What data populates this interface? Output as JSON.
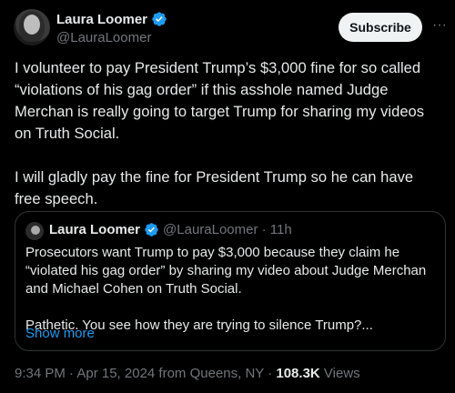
{
  "author": {
    "display_name": "Laura Loomer",
    "handle": "@LauraLoomer",
    "verified_icon": "verified-badge-icon"
  },
  "actions": {
    "subscribe_label": "Subscribe",
    "more_label": "···"
  },
  "tweet": {
    "paragraphs": [
      "I volunteer to pay President Trump’s $3,000 fine for so called “violations of his gag order” if this asshole named Judge Merchan is really going to target Trump for sharing my videos on Truth Social.",
      "I will gladly pay the fine for President Trump so he can have free speech."
    ]
  },
  "quote": {
    "display_name": "Laura Loomer",
    "handle_time": "@LauraLoomer · 11h",
    "paragraphs": [
      "Prosecutors want Trump to pay $3,000 because they claim he “violated his gag order” by sharing my video about Judge Merchan and Michael Cohen on Truth Social.",
      "Pathetic. You see how they are trying to silence Trump?..."
    ],
    "show_more": "Show more"
  },
  "footer": {
    "timestamp": "9:34 PM · Apr 15, 2024 from Queens, NY ·",
    "views_count": "108.3K",
    "views_label": "Views"
  },
  "colors": {
    "background": "#000000",
    "text": "#e7e9ea",
    "muted": "#71767b",
    "accent": "#1d9bf0",
    "border": "#2f3336"
  }
}
